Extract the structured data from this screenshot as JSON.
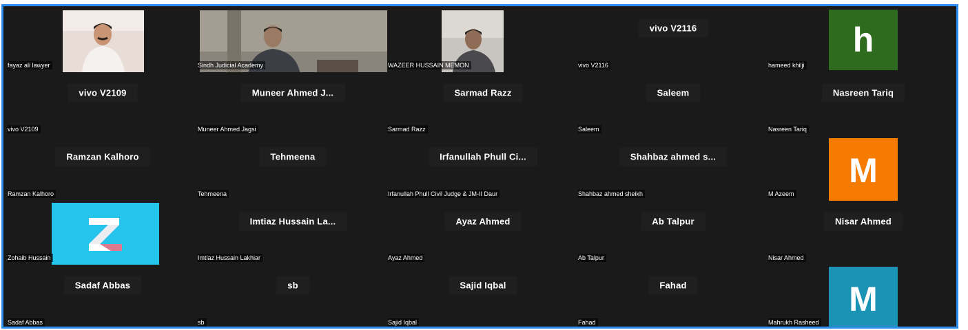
{
  "meeting": {
    "tiles": [
      {
        "label": "fayaz ali lawyer",
        "center": ""
      },
      {
        "label": "Sindh Judicial Academy",
        "center": ""
      },
      {
        "label": "WAZEER HUSSAIN MEMON",
        "center": ""
      },
      {
        "label": "vivo V2116",
        "center": "vivo V2116"
      },
      {
        "label": "hameed khilji",
        "center": ""
      },
      {
        "label": "vivo V2109",
        "center": "vivo V2109"
      },
      {
        "label": "Muneer Ahmed Jagsi",
        "center": "Muneer Ahmed J..."
      },
      {
        "label": "Sarmad Razz",
        "center": "Sarmad Razz"
      },
      {
        "label": "Saleem",
        "center": "Saleem"
      },
      {
        "label": "Nasreen Tariq",
        "center": "Nasreen Tariq"
      },
      {
        "label": "Ramzan Kalhoro",
        "center": "Ramzan Kalhoro"
      },
      {
        "label": "Tehmeena",
        "center": "Tehmeena"
      },
      {
        "label": "Irfanullah Phull Civil Judge & JM-II Daur",
        "center": "Irfanullah Phull Ci..."
      },
      {
        "label": "Shahbaz ahmed sheikh",
        "center": "Shahbaz ahmed s..."
      },
      {
        "label": "M Azeem",
        "center": ""
      },
      {
        "label": "Zohaib Hussain",
        "center": ""
      },
      {
        "label": "Imtiaz Hussain Lakhiar",
        "center": "Imtiaz Hussain La..."
      },
      {
        "label": "Ayaz Ahmed",
        "center": "Ayaz Ahmed"
      },
      {
        "label": "Ab Talpur",
        "center": "Ab Talpur"
      },
      {
        "label": "Nisar Ahmed",
        "center": "Nisar Ahmed"
      },
      {
        "label": "Sadaf Abbas",
        "center": "Sadaf Abbas"
      },
      {
        "label": "sb",
        "center": "sb"
      },
      {
        "label": "Sajid Iqbal",
        "center": "Sajid Iqbal"
      },
      {
        "label": "Fahad",
        "center": "Fahad"
      },
      {
        "label": "Mahrukh Rasheed",
        "center": ""
      }
    ],
    "avatars": {
      "hameed": {
        "letter": "h",
        "color": "#2e6b1f"
      },
      "azeem": {
        "letter": "M",
        "color": "#f57c00"
      },
      "mahrukh": {
        "letter": "M",
        "color": "#1b93b5"
      },
      "zohaib": {
        "letter": "Z",
        "color": "#25c4ec"
      }
    },
    "colors": {
      "background": "#1a1a1a",
      "active_speaker_border": "#2d8cf0"
    }
  }
}
